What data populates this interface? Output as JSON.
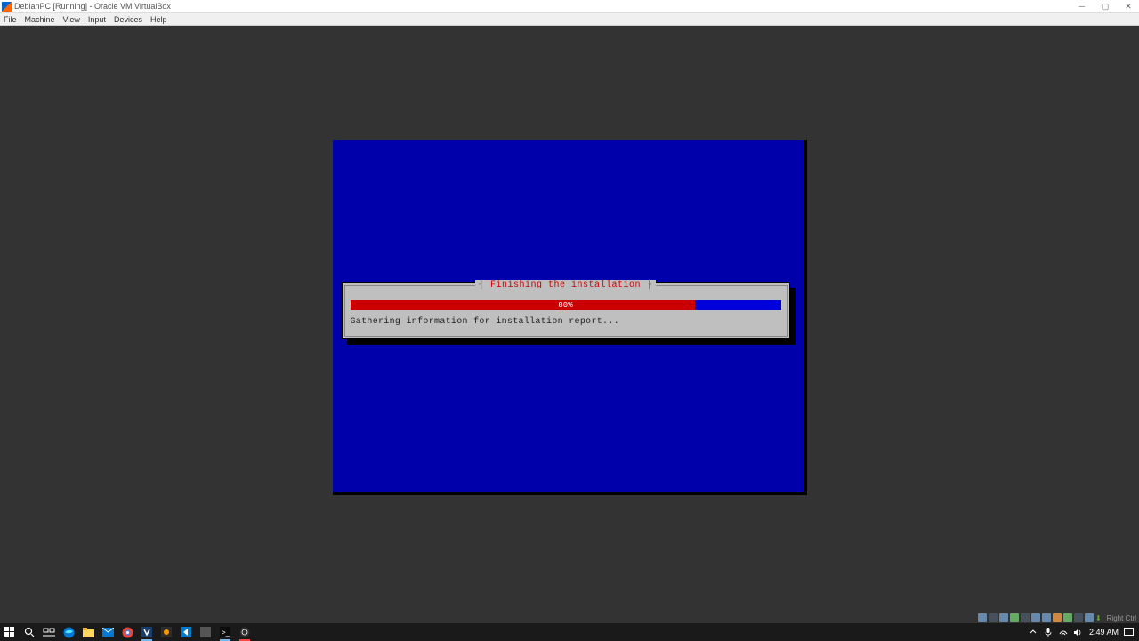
{
  "titlebar": {
    "text": "DebianPC [Running] - Oracle VM VirtualBox"
  },
  "menubar": {
    "items": [
      "File",
      "Machine",
      "View",
      "Input",
      "Devices",
      "Help"
    ]
  },
  "installer": {
    "title": "Finishing the installation",
    "progress_percent": 80,
    "progress_label": "80%",
    "status": "Gathering information for installation report..."
  },
  "vbox_status": {
    "host_key": "Right Ctrl"
  },
  "taskbar": {
    "clock": "2:49 AM"
  }
}
